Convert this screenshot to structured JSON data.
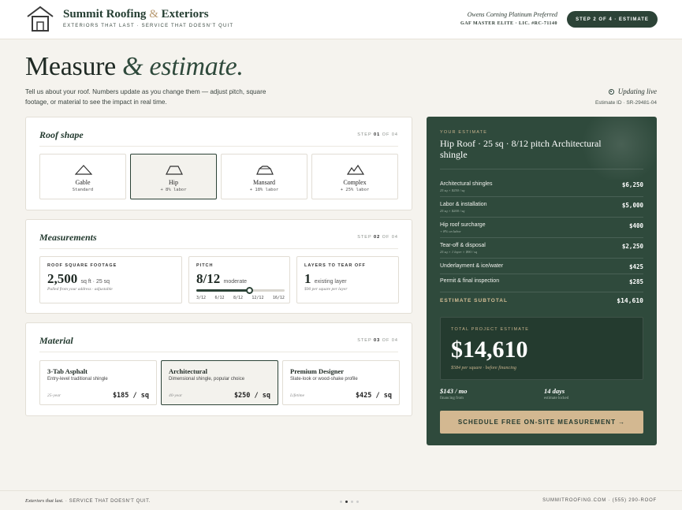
{
  "header": {
    "brand_name": "Summit Roofing",
    "brand_amp": "&",
    "brand_name2": "Exteriors",
    "tagline": "EXTERIORS THAT LAST · SERVICE THAT DOESN'T QUIT",
    "cert_line1": "Owens Corning Platinum Preferred",
    "cert_line2": "GAF MASTER ELITE · LIC. #RC-71140",
    "step_button": "STEP 2 OF 4 · ESTIMATE"
  },
  "hero": {
    "title": "Measure",
    "title_italic": "& estimate.",
    "intro": "Tell us about your roof. Numbers update as you change them — adjust pitch, square footage, or material to see the impact in real time.",
    "live_label": "Updating live",
    "estimate_id": "Estimate ID · SR-29481-04"
  },
  "roof_shape": {
    "title": "Roof shape",
    "step_prefix": "STEP",
    "step_num": "01",
    "step_suffix": "OF 04",
    "options": [
      {
        "name": "Gable",
        "sub": "Standard",
        "icon": "gable-roof-icon",
        "selected": false
      },
      {
        "name": "Hip",
        "sub": "+ 8% labor",
        "icon": "hip-roof-icon",
        "selected": true
      },
      {
        "name": "Mansard",
        "sub": "+ 18% labor",
        "icon": "mansard-roof-icon",
        "selected": false
      },
      {
        "name": "Complex",
        "sub": "+ 25% labor",
        "icon": "complex-roof-icon",
        "selected": false
      }
    ]
  },
  "measurements": {
    "title": "Measurements",
    "step_prefix": "STEP",
    "step_num": "02",
    "step_suffix": "OF 04",
    "sqft": {
      "label": "ROOF SQUARE FOOTAGE",
      "value": "2,500",
      "unit": "sq ft · 25 sq",
      "note": "Pulled from your address · adjustable"
    },
    "pitch": {
      "label": "PITCH",
      "value": "8/12",
      "unit": "moderate",
      "level": 0.6,
      "ticks": [
        "3/12",
        "6/12",
        "8/12",
        "12/12",
        "16/12"
      ]
    },
    "layers": {
      "label": "LAYERS TO TEAR OFF",
      "value": "1",
      "unit": "existing layer",
      "note": "$90 per square per layer"
    }
  },
  "material": {
    "title": "Material",
    "step_prefix": "STEP",
    "step_num": "03",
    "step_suffix": "OF 04",
    "options": [
      {
        "name": "3-Tab Asphalt",
        "desc": "Entry-level traditional shingle",
        "life": "25-year",
        "price": "$185 / sq",
        "selected": false
      },
      {
        "name": "Architectural",
        "desc": "Dimensional shingle, popular choice",
        "life": "40-year",
        "price": "$250 / sq",
        "selected": true
      },
      {
        "name": "Premium Designer",
        "desc": "Slate-look or wood-shake profile",
        "life": "Lifetime",
        "price": "$425 / sq",
        "selected": false
      }
    ]
  },
  "estimate": {
    "label": "YOUR ESTIMATE",
    "title": "Hip Roof · 25 sq · 8/12 pitch Architectural shingle",
    "lines": [
      {
        "name": "Architectural shingles",
        "sub": "25 sq × $250 / sq",
        "value": "$6,250"
      },
      {
        "name": "Labor & installation",
        "sub": "25 sq × $200 / sq",
        "value": "$5,000"
      },
      {
        "name": "Hip roof surcharge",
        "sub": "+ 8% on labor",
        "value": "$400"
      },
      {
        "name": "Tear-off & disposal",
        "sub": "25 sq × 1 layer × $90 / sq",
        "value": "$2,250"
      },
      {
        "name": "Underlayment & ice/water",
        "sub": "",
        "value": "$425"
      },
      {
        "name": "Permit & final inspection",
        "sub": "",
        "value": "$285"
      }
    ],
    "subtotal_label": "ESTIMATE SUBTOTAL",
    "subtotal_value": "$14,610",
    "total_label": "TOTAL PROJECT ESTIMATE",
    "total_value": "$14,610",
    "total_note": "$584 per square · before financing",
    "financing_value": "$143 / mo",
    "financing_label": "financing from",
    "locked_value": "14 days",
    "locked_label": "estimate locked",
    "cta": "SCHEDULE FREE ON-SITE MEASUREMENT →"
  },
  "footer": {
    "left_italic": "Exteriors that last.",
    "left_rest": "· SERVICE THAT DOESN'T QUIT.",
    "right": "SUMMITROOFING.COM · (555) 290-ROOF",
    "page_dots": 4,
    "active_dot": 1
  },
  "colors": {
    "brand_green": "#2f4a3c",
    "accent_tan": "#d3b891",
    "background": "#f5f3ee"
  }
}
